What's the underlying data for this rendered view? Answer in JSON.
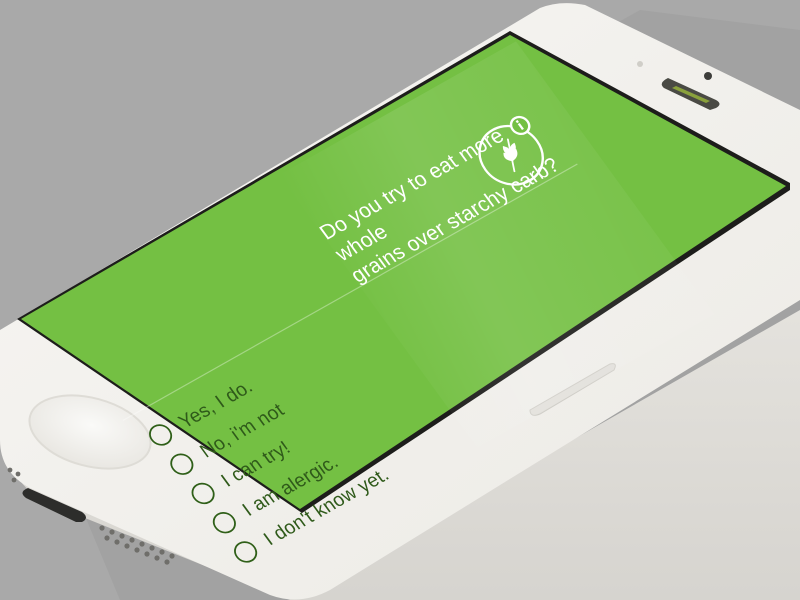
{
  "colors": {
    "background": "#a9a9a9",
    "phone_body": "#f4f3f0",
    "screen_green": "#74c043",
    "question_text": "#ffffff",
    "option_text": "#2f5a1a"
  },
  "question": {
    "line1": "Do you try to eat more whole",
    "line2": "grains over starchy carb?",
    "icon": "wheat-icon",
    "info_icon": "info-icon"
  },
  "options": [
    {
      "label": "Yes, I do.",
      "selected": false
    },
    {
      "label": "No, i'm not",
      "selected": false
    },
    {
      "label": "I can try!",
      "selected": false
    },
    {
      "label": "I am alergic.",
      "selected": false
    },
    {
      "label": "I don't know yet.",
      "selected": false
    }
  ]
}
